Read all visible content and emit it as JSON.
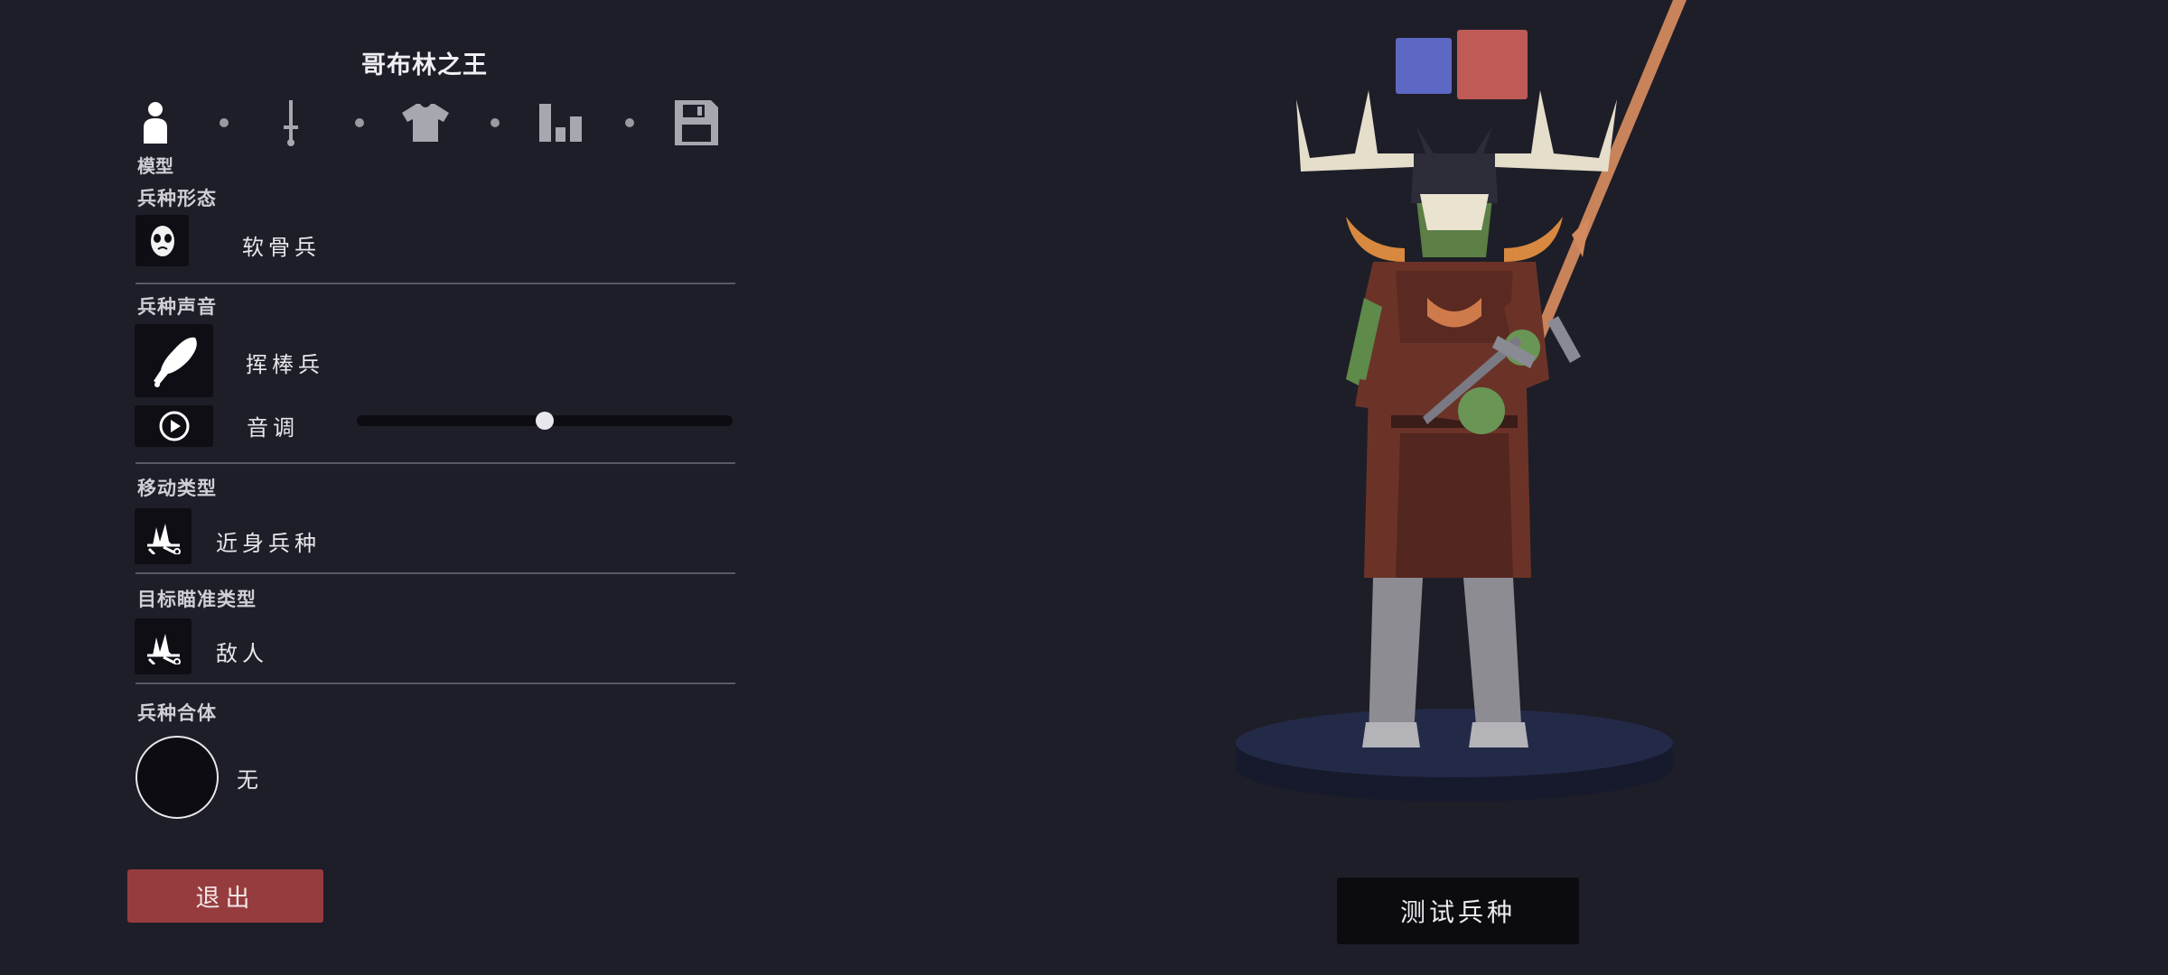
{
  "unit": {
    "title": "哥布林之王"
  },
  "tabs": {
    "active_caption": "模型",
    "items": [
      {
        "icon": "person-icon"
      },
      {
        "icon": "sword-icon"
      },
      {
        "icon": "shirt-icon"
      },
      {
        "icon": "stats-icon"
      },
      {
        "icon": "save-icon"
      }
    ]
  },
  "sections": {
    "form": {
      "label": "兵种形态",
      "value": "软骨兵",
      "icon": "mask-icon"
    },
    "voice": {
      "label": "兵种声音",
      "value": "挥棒兵",
      "icon": "club-icon",
      "pitch_label": "音调",
      "pitch_level": 0.5,
      "play_icon": "play-icon"
    },
    "movement": {
      "label": "移动类型",
      "value": "近身兵种",
      "icon": "melee-icon"
    },
    "targeting": {
      "label": "目标瞄准类型",
      "value": "敌人",
      "icon": "melee-icon"
    },
    "combine": {
      "label": "兵种合体",
      "value": "无"
    }
  },
  "buttons": {
    "exit": "退出",
    "test_unit": "测试兵种"
  },
  "team_colors": {
    "blue": "#5c68c4",
    "red": "#bf5a57"
  },
  "colors": {
    "background": "#1e1e28",
    "exit_button": "#963c3e",
    "panel_dark": "#0e0e14"
  }
}
